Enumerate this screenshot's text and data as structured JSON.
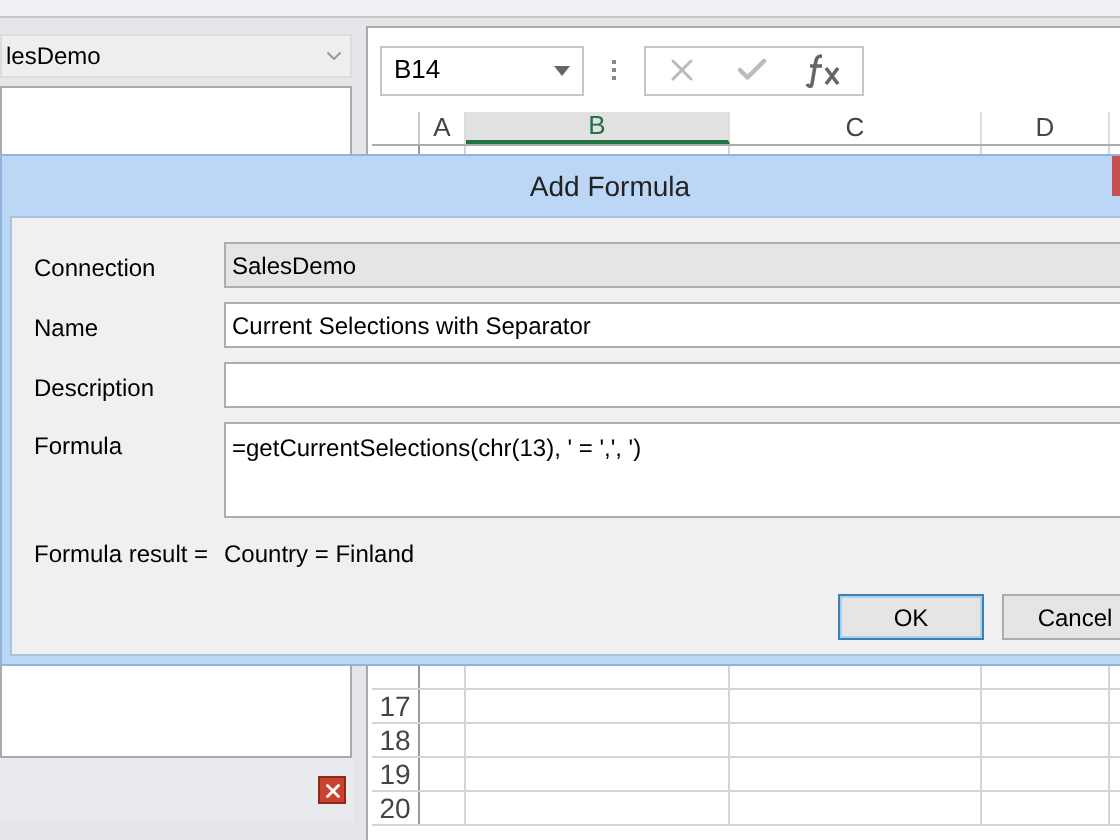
{
  "connection_picker": {
    "value": "lesDemo"
  },
  "formula_bar": {
    "name_box": "B14"
  },
  "sheet": {
    "columns": [
      {
        "label": "A",
        "selected": false
      },
      {
        "label": "B",
        "selected": true
      },
      {
        "label": "C",
        "selected": false
      },
      {
        "label": "D",
        "selected": false
      }
    ],
    "rows": [
      {
        "label": "17"
      },
      {
        "label": "18"
      },
      {
        "label": "19"
      },
      {
        "label": "20"
      }
    ]
  },
  "dialog": {
    "title": "Add Formula",
    "fields": [
      {
        "label": "Connection",
        "kind": "combo",
        "value": "SalesDemo"
      },
      {
        "label": "Name",
        "kind": "text",
        "value": "Current Selections with Separator"
      },
      {
        "label": "Description",
        "kind": "text"
      },
      {
        "label": "Formula",
        "kind": "multiline",
        "value": "=getCurrentSelections(chr(13), ' = ',', ')"
      }
    ],
    "result": {
      "label": "Formula result =",
      "value": "Country = Finland"
    },
    "buttons": [
      {
        "label": "OK",
        "default": true
      },
      {
        "label": "Cancel",
        "default": false
      }
    ]
  }
}
